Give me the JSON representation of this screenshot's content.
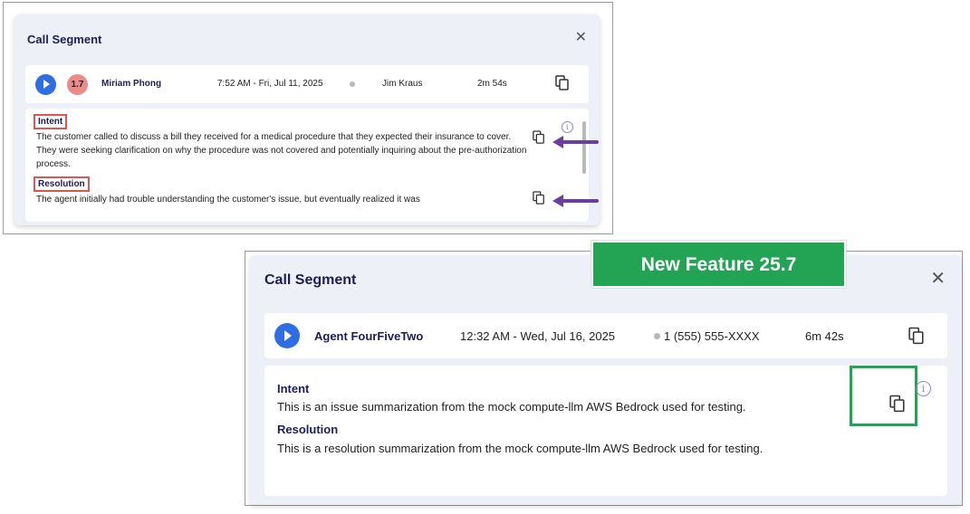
{
  "old_panel": {
    "title": "Call Segment",
    "close_icon": "close-icon",
    "row": {
      "score": "1.7",
      "agent": "Miriam Phong",
      "datetime": "7:52 AM - Fri, Jul 11, 2025",
      "customer": "Jim Kraus",
      "duration": "2m 54s"
    },
    "intent_label": "Intent",
    "intent_text": "The customer called to discuss a bill they received for a medical procedure that they expected their insurance to cover. They were seeking clarification on why the procedure was not covered and potentially inquiring about the pre-authorization process.",
    "resolution_label": "Resolution",
    "resolution_text": "The agent initially had trouble understanding the customer's issue, but eventually realized it was",
    "annotation_colors": {
      "label_box": "#e0554f",
      "arrow": "#6b3fa0"
    }
  },
  "new_panel": {
    "title": "Call Segment",
    "feature_badge": "New Feature 25.7",
    "row": {
      "agent": "Agent FourFiveTwo",
      "datetime": "12:32 AM - Wed, Jul 16, 2025",
      "customer": "1 (555) 555-XXXX",
      "duration": "6m 42s"
    },
    "intent_label": "Intent",
    "intent_text": "This is an issue summarization from the mock compute-llm AWS Bedrock used for testing.",
    "resolution_label": "Resolution",
    "resolution_text": "This is a resolution summarization from the mock compute-llm AWS Bedrock used for testing.",
    "annotation_colors": {
      "highlight_box": "#23a455"
    }
  },
  "colors": {
    "accent": "#2f6de4",
    "score_badge": "#ea8a8a",
    "panel_bg": "#eef0f8",
    "title": "#1b1f55"
  }
}
